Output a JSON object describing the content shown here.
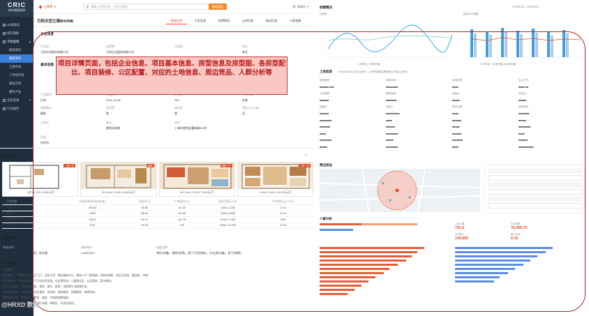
{
  "brand": {
    "title": "CRIC",
    "subtitle": "城市楼盘系统"
  },
  "sidebar": {
    "items": [
      {
        "label": "3D城动态"
      },
      {
        "label": "城市看板"
      },
      {
        "label": "市场监测"
      },
      {
        "label": "板块项目"
      },
      {
        "label": "楼盘项目"
      },
      {
        "label": "土地市场"
      },
      {
        "label": "二手房市场"
      },
      {
        "label": "新房市场"
      },
      {
        "label": "服务产业"
      },
      {
        "label": "企业监测"
      },
      {
        "label": "行业报告"
      }
    ]
  },
  "topbar": {
    "city": "上海市",
    "search_placeholder": "请输入项目名称、企业名称等",
    "search_button": "搜索楼盘",
    "user": "管理员"
  },
  "project": {
    "name": "万科天空之境8HOME",
    "tabs": [
      "基本信息",
      "户型信息",
      "经营情况",
      "土地信息",
      "周边信息",
      "人群画像"
    ]
  },
  "enterprise": {
    "title": "企业信息",
    "fields": [
      {
        "k": "开发商",
        "v": "万科企业股份有限公司"
      },
      {
        "k": "运营商",
        "v": "万科企业股份有限公司"
      },
      {
        "k": "代理商",
        "v": "-"
      },
      {
        "k": "物业",
        "v": "商业"
      }
    ]
  },
  "basic": {
    "title": "基本信息",
    "fields": [
      {
        "k": "产品类型",
        "v": "住宅"
      },
      {
        "k": "开盘时间",
        "v": "2021-10-28"
      },
      {
        "k": "总建面",
        "v": "240"
      },
      {
        "k": "开发阶段",
        "v": "在售"
      },
      {
        "k": "装修情况",
        "v": "精装"
      },
      {
        "k": "容积率",
        "v": "是"
      },
      {
        "k": "绿化率",
        "v": "是"
      },
      {
        "k": "是否人才公寓",
        "v": "否"
      },
      {
        "k": "土地价",
        "v": "-"
      },
      {
        "k": "板块",
        "v": "普陀区新城"
      },
      {
        "k": "地址",
        "v": "上海市普陀区曹杨路999号"
      },
      {
        "k": "环线",
        "v": "内环内"
      }
    ]
  },
  "callout": {
    "text": "项目详情页面，包括企业信息、项目基本信息、房型信息及房型图、各房型配比、项目装修、公区配置、对应的土地信息、周边竞品、人群分析等"
  },
  "floorplans": {
    "title": "户型信息",
    "cards": [
      {
        "label": "二房 | 4,700–5,300元/月",
        "tag": "一房一厅"
      },
      {
        "label": "45–55m² | 3,500–4,500元/月",
        "tag": "两房"
      },
      {
        "label": "50–78m² | 5,000–7,000元/月",
        "tag": "两房一厅"
      },
      {
        "label": "120m² | 8,500–12,000元/月",
        "tag": "三房一厅"
      }
    ],
    "table_headers": [
      "户型名称",
      "在租房源/房源总数(套)",
      "出租率(%)",
      "户型面积(m²)",
      "租金范围(元/月)",
      "平均租金(元/m²/月)"
    ],
    "rows": [
      [
        "一房一厅",
        "29/120",
        "94.55",
        "37–42",
        "2,500–3,200",
        "17.97"
      ],
      [
        "两房",
        "10/20",
        "88.54",
        "45–55",
        "3,500–4,500",
        "12.11"
      ],
      [
        "两房一厅三房",
        "15/15",
        "80.74",
        "50–78",
        "5,000–7,000",
        "9.54"
      ],
      [
        "一厅",
        "5/10",
        "90.30",
        "120",
        "8,500–12,000",
        "10.33"
      ]
    ]
  },
  "decor": {
    "title": "装修信息",
    "headers": [
      "装修说明",
      "装修单价",
      "电器品牌"
    ],
    "values": [
      "冰箱、电视、空调、洗衣机、热水器",
      "1,400元/m²",
      "海尔(冰箱)、美的(空调)、西门子(洗衣机)、方太(热水器)、松下(电视)"
    ]
  },
  "public": {
    "title": "公区配置",
    "lines": [
      "公区配置",
      "配置说明：户楼梯间设有独立门厅，设有大堂、物业服务中心，楼栋入户门禁系统，设有快递柜、社区活动室、健身房、书吧；",
      "地下室停车：设有充电桩，下沉式社区花园，社区便利店，儿童游乐区，社区超市，菜鸟驿站；",
      "周边社区配套：品牌连锁商超、餐饮、银行、医院、学校等生活配套齐全；",
      "周边配套服务：社区医院、社区食堂、洗衣房、维修服务、家政服务、养老驿站；",
      "免费增值服务：提供保洁、搬家、维修、代收快递等服务；",
      "其他配套设施：立体停车库、自行车棚、晾晒区、垃圾分类站；"
    ]
  },
  "right": {
    "ops_title": "经营情况",
    "ops_date": "2022年2月 – 2023年2月",
    "chart1_title": "出租率",
    "chart2_title": "租金水平指数",
    "chart1_legend": [
      "本项目",
      "板块均值"
    ],
    "chart2_legend": [
      "本项目",
      "板块均值",
      "区域均值"
    ],
    "land_title": "土地信息",
    "land_sub": "2016年06月公开出让地块（上海市普陀区曹杨路土地出让地块）",
    "land_labels": [
      "地块编号",
      "地块名称",
      "用地性质",
      "出让方式",
      "土地面积",
      "建筑面积",
      "起始价",
      "成交价",
      "楼面价",
      "竞得人",
      "成交日期",
      "规划指标"
    ],
    "map_title": "周边竞品",
    "people_title": "人群分析",
    "stats": [
      {
        "label": "入住人数",
        "value": "792.6"
      },
      {
        "label": "平均年龄",
        "value": "76,058.79"
      },
      {
        "label": "平均收入",
        "value": "129,609"
      },
      {
        "label": "租户比例",
        "value": "0.34"
      }
    ]
  },
  "watermark": "@HRXD 数据"
}
